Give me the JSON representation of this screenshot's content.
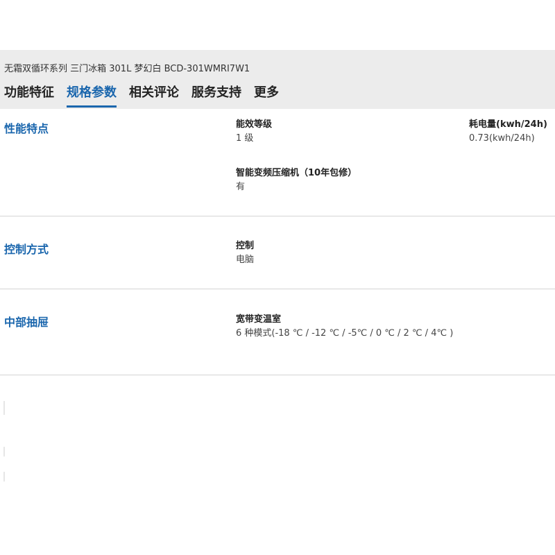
{
  "product": {
    "title": "无霜双循环系列 三门冰箱 301L 梦幻白 BCD-301WMRI7W1"
  },
  "tabs": [
    {
      "label": "功能特征",
      "active": false
    },
    {
      "label": "规格参数",
      "active": true
    },
    {
      "label": "相关评论",
      "active": false
    },
    {
      "label": "服务支持",
      "active": false
    },
    {
      "label": "更多",
      "active": false
    }
  ],
  "colors": {
    "accent": "#1a66ad",
    "header_bg": "#ececec",
    "divider": "#d4d4d4"
  },
  "sections": [
    {
      "title": "性能特点",
      "specs": [
        {
          "label": "能效等级",
          "value": "1 级"
        },
        {
          "label": "耗电量(kwh/24h)",
          "value": "0.73(kwh/24h)"
        },
        {
          "label": "智能变频压缩机（10年包修）",
          "value": "有"
        }
      ]
    },
    {
      "title": "控制方式",
      "specs": [
        {
          "label": "控制",
          "value": "电脑"
        }
      ]
    },
    {
      "title": "中部抽屉",
      "specs": [
        {
          "label": "宽带变温室",
          "value": "6 种模式(-18 ℃ / -12 ℃ / -5℃ / 0 ℃ / 2 ℃ / 4℃ )"
        }
      ]
    }
  ]
}
